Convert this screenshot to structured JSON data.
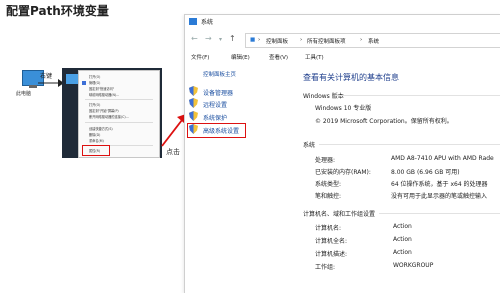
{
  "slide_title": "配置Path环境变量",
  "desktop": {
    "icon_label": "此电脑",
    "right_click_label": "右键"
  },
  "context_menu": {
    "items": [
      "打开(O)",
      "管理(G)",
      "固定到\"快速访问\"",
      "映射网络驱动器(N)...",
      "打开(O)",
      "固定到\"开始\"屏幕(P)",
      "断开网络驱动器的连接(C)...",
      "创建快捷方式(S)",
      "删除(D)",
      "重命名(M)",
      "属性(R)"
    ],
    "highlighted_item": "属性(R)"
  },
  "click_label": "点击",
  "window": {
    "title": "系统",
    "breadcrumb": [
      "控制面板",
      "所有控制面板项",
      "系统"
    ],
    "menubar": [
      "文件(F)",
      "编辑(E)",
      "查看(V)",
      "工具(T)"
    ],
    "left_panel": {
      "home": "控制面板主页",
      "links": [
        "设备管理器",
        "远程设置",
        "系统保护",
        "高级系统设置"
      ],
      "highlighted_link": "高级系统设置"
    },
    "main_title": "查看有关计算机的基本信息",
    "windows_edition": {
      "heading": "Windows 版本",
      "edition": "Windows 10 专业版",
      "copyright": "© 2019 Microsoft Corporation。保留所有权利。"
    },
    "system": {
      "heading": "系统",
      "rows": [
        {
          "label": "处理器:",
          "value": "AMD A8-7410 APU with AMD Rade"
        },
        {
          "label": "已安装的内存(RAM):",
          "value": "8.00 GB (6.96 GB 可用)"
        },
        {
          "label": "系统类型:",
          "value": "64 位操作系统，基于 x64 的处理器"
        },
        {
          "label": "笔和触控:",
          "value": "没有可用于此显示器的笔或触控输入"
        }
      ]
    },
    "computer": {
      "heading": "计算机名、域和工作组设置",
      "rows": [
        {
          "label": "计算机名:",
          "value": "Action"
        },
        {
          "label": "计算机全名:",
          "value": "Action"
        },
        {
          "label": "计算机描述:",
          "value": "Action"
        },
        {
          "label": "工作组:",
          "value": "WORKGROUP"
        }
      ]
    }
  },
  "colors": {
    "highlight_border": "#d11111",
    "link": "#1a4ea0",
    "title": "#1e3e8c"
  }
}
